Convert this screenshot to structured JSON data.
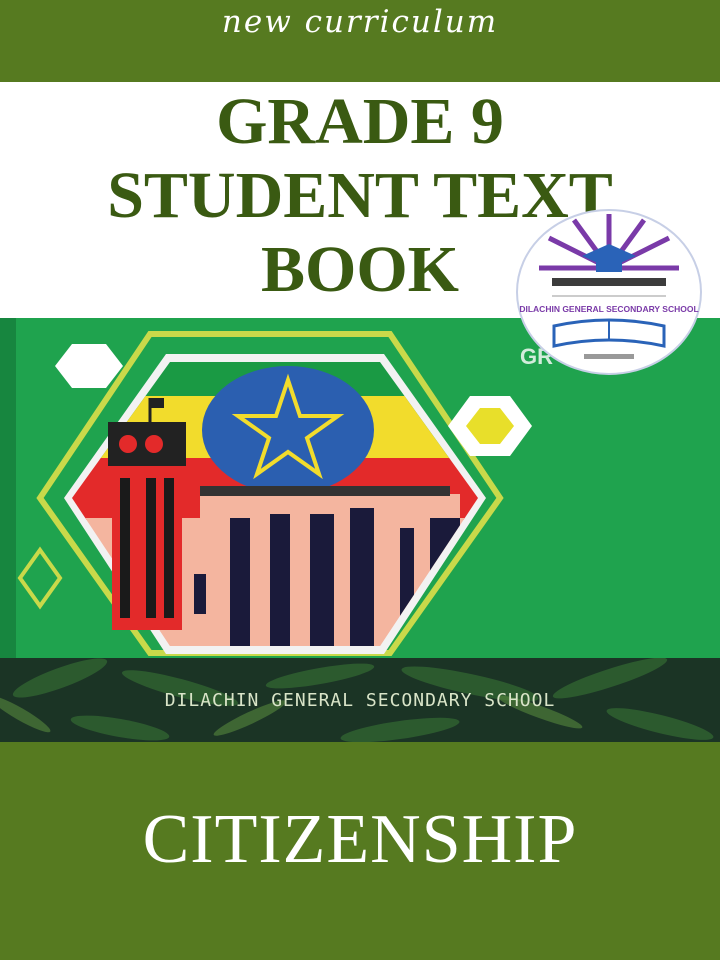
{
  "header": {
    "tagline": "new curriculum"
  },
  "title": {
    "line1": "GRADE 9",
    "line2": "STUDENT TEXT",
    "line3": "BOOK"
  },
  "logo": {
    "school_name": "DILACHIN GENERAL SECONDARY SCHOOL"
  },
  "banner": {
    "school_name": "DILACHIN GENERAL SECONDARY SCHOOL"
  },
  "subject": "CITIZENSHIP",
  "colors": {
    "band_green": "#567a20",
    "title_green": "#3a5a12",
    "cover_green": "#1fa34e"
  }
}
